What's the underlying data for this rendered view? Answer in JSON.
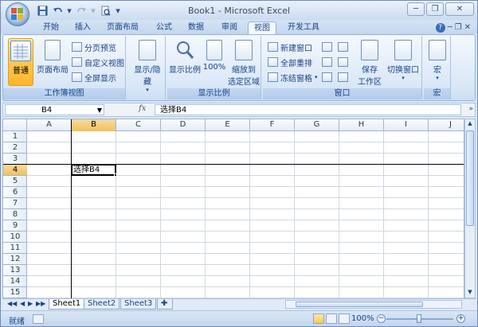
{
  "window": {
    "title": "Book1 - Microsoft Excel"
  },
  "qat": {
    "save_icon": "save-icon",
    "undo_icon": "undo-icon",
    "redo_icon": "redo-icon",
    "print_preview_icon": "print-preview-icon",
    "customize_icon": "chevron-down-icon"
  },
  "tabs": [
    {
      "label": "开始"
    },
    {
      "label": "插入"
    },
    {
      "label": "页面布局"
    },
    {
      "label": "公式"
    },
    {
      "label": "数据"
    },
    {
      "label": "审阅"
    },
    {
      "label": "视图",
      "active": true
    },
    {
      "label": "开发工具"
    }
  ],
  "ribbon": {
    "workbook_views": {
      "label": "工作簿视图",
      "normal": "普通",
      "page_layout": "页面布局",
      "page_break_preview": "分页预览",
      "custom_views": "自定义视图",
      "full_screen": "全屏显示"
    },
    "show_hide": {
      "label": "显示/隐藏"
    },
    "zoom": {
      "label": "显示比例",
      "zoom": "显示比例",
      "zoom100": "100%",
      "zoom_to_selection_l1": "缩放到",
      "zoom_to_selection_l2": "选定区域"
    },
    "window": {
      "label": "窗口",
      "new_window": "新建窗口",
      "arrange_all": "全部重排",
      "freeze_panes": "冻结窗格",
      "save_workspace_l1": "保存",
      "save_workspace_l2": "工作区",
      "switch_windows": "切换窗口"
    },
    "macros": {
      "label": "宏",
      "macros": "宏"
    }
  },
  "formula_bar": {
    "name_box": "B4",
    "fx": "fx",
    "value": "选择B4"
  },
  "grid": {
    "columns": [
      "A",
      "B",
      "C",
      "D",
      "E",
      "F",
      "G",
      "H",
      "I",
      "J"
    ],
    "rows": [
      "1",
      "2",
      "3",
      "4",
      "5",
      "6",
      "7",
      "8",
      "9",
      "10",
      "11",
      "12",
      "13",
      "14",
      "15"
    ],
    "selected_column": "B",
    "selected_row": "4",
    "active_cell_value": "选择B4"
  },
  "sheets": [
    {
      "label": "Sheet1",
      "active": true
    },
    {
      "label": "Sheet2"
    },
    {
      "label": "Sheet3"
    }
  ],
  "status": {
    "text": "就绪",
    "zoom": "100%"
  }
}
